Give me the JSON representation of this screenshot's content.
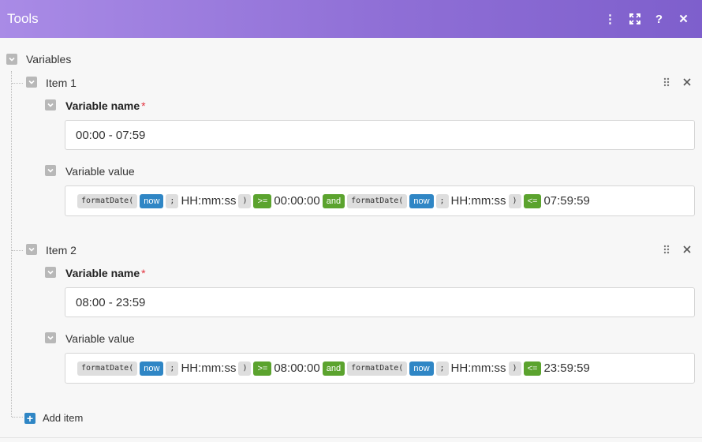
{
  "header": {
    "title": "Tools",
    "actions": {
      "more": "⋮",
      "expand": "⤢",
      "help": "?",
      "close": "✕"
    },
    "gradient": [
      "#a98be6",
      "#7e5fcc"
    ]
  },
  "variables": {
    "label": "Variables",
    "add_item_label": "Add item",
    "items": [
      {
        "title": "Item 1",
        "name_label": "Variable name",
        "required_mark": "*",
        "name_value": "00:00 - 07:59",
        "value_label": "Variable value",
        "expr": {
          "fn1": "formatDate(",
          "var1": "now",
          "sep1": ";",
          "fmt1": "HH:mm:ss",
          "close1": ")",
          "op1": ">=",
          "val1": "00:00:00",
          "and": "and",
          "fn2": "formatDate(",
          "var2": "now",
          "sep2": ";",
          "fmt2": "HH:mm:ss",
          "close2": ")",
          "op2": "<=",
          "val2": "07:59:59"
        }
      },
      {
        "title": "Item 2",
        "name_label": "Variable name",
        "required_mark": "*",
        "name_value": "08:00 - 23:59",
        "value_label": "Variable value",
        "expr": {
          "fn1": "formatDate(",
          "var1": "now",
          "sep1": ";",
          "fmt1": "HH:mm:ss",
          "close1": ")",
          "op1": ">=",
          "val1": "08:00:00",
          "and": "and",
          "fn2": "formatDate(",
          "var2": "now",
          "sep2": ";",
          "fmt2": "HH:mm:ss",
          "close2": ")",
          "op2": "<=",
          "val2": "23:59:59"
        }
      }
    ]
  },
  "colors": {
    "function_pill": "#dedede",
    "variable_pill": "#2f86c5",
    "operator_pill": "#5ba32e",
    "required": "#e2333f"
  }
}
